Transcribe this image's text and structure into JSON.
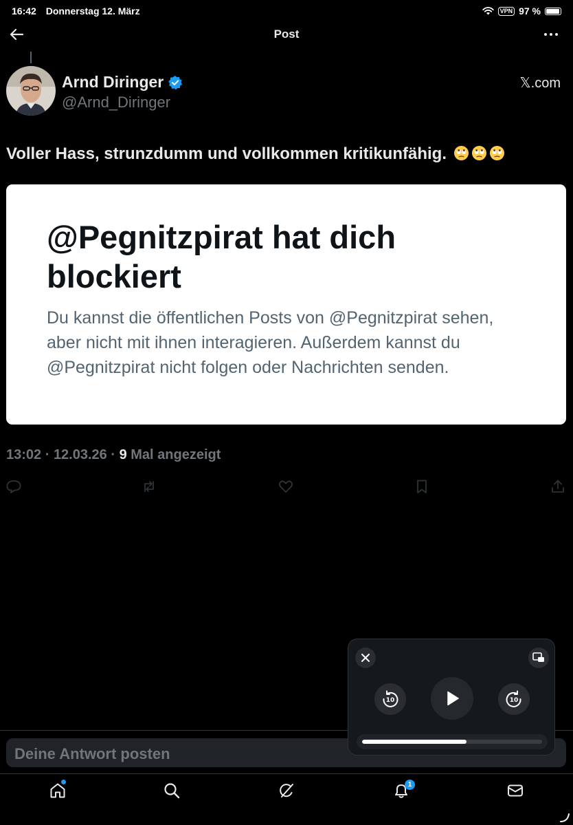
{
  "status_bar": {
    "time": "16:42",
    "date": "Donnerstag 12. März",
    "vpn": "VPN",
    "battery": "97 %",
    "battery_level": 0.97
  },
  "header": {
    "title": "Post"
  },
  "post": {
    "author": {
      "name": "Arnd Diringer",
      "handle": "@Arnd_Diringer",
      "verified": true
    },
    "site": "𝕏.com",
    "text": "Voller Hass, strunzdumm und vollkommen kritikunfähig.",
    "emoji": "face-with-rolling-eyes",
    "emoji_count": 3,
    "card": {
      "title": "@Pegnitzpirat hat dich blockiert",
      "body": "Du kannst die öffentlichen Posts von @Pegnitzpirat sehen, aber nicht mit ihnen interagieren. Außerdem kannst du @Pegnitzpirat nicht folgen oder Nachrichten senden."
    },
    "meta": {
      "time": "13:02",
      "date": "12.03.26",
      "views": "9",
      "views_label": "Mal angezeigt"
    }
  },
  "reply": {
    "placeholder": "Deine Antwort posten"
  },
  "bottom_nav": {
    "notification_count": "1"
  },
  "mini_player": {
    "rewind_seconds": "10",
    "forward_seconds": "10",
    "progress": 0.58
  },
  "colors": {
    "background": "#000000",
    "accent": "#1d9bf0",
    "muted": "#71767b",
    "card_bg": "#ffffff"
  }
}
